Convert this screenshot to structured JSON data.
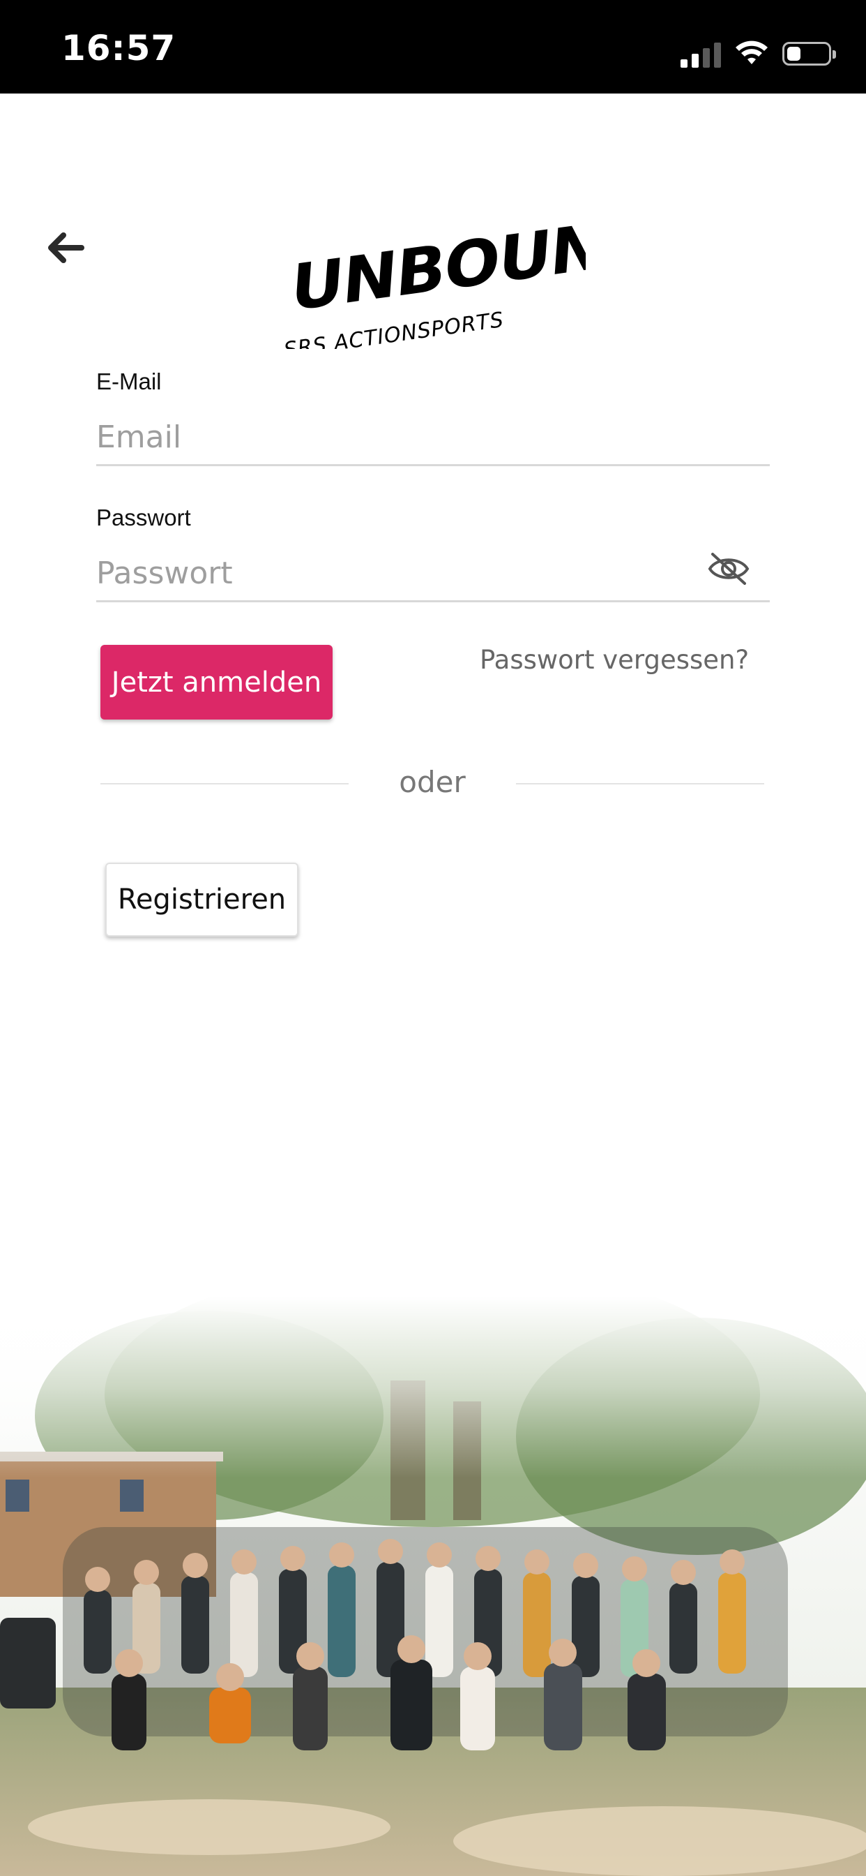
{
  "status_bar": {
    "time": "16:57"
  },
  "header": {
    "back_icon": "arrow-left-icon",
    "logo_text": "UNBOUND",
    "logo_subtext": "SRS ACTIONSPORTS"
  },
  "form": {
    "email": {
      "label": "E-Mail",
      "placeholder": "Email",
      "value": ""
    },
    "password": {
      "label": "Passwort",
      "placeholder": "Passwort",
      "value": "",
      "toggle_icon": "eye-off-icon"
    },
    "login_button": "Jetzt anmelden",
    "forgot_link": "Passwort vergessen?",
    "separator": "oder",
    "register_button": "Registrieren"
  },
  "colors": {
    "primary": "#dc2867",
    "status_bar": "#000000",
    "divider": "#e3e3e3"
  },
  "photo": {
    "subject": "group-photo"
  }
}
